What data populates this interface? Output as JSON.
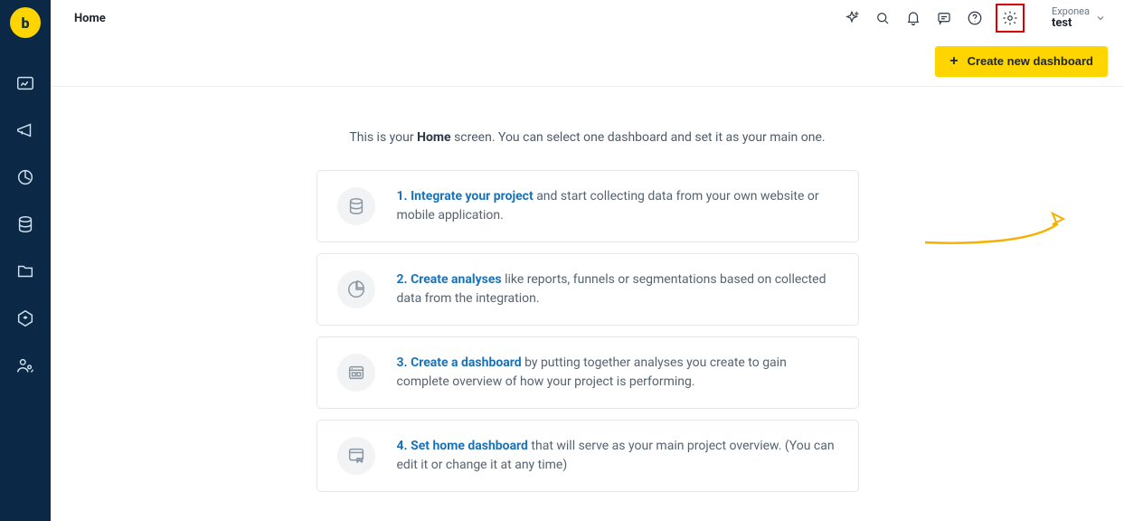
{
  "sidebar": {
    "logo_glyph": "b"
  },
  "topbar": {
    "title": "Home",
    "project": {
      "org": "Exponea",
      "name": "test"
    }
  },
  "actions": {
    "create_dashboard": "Create new dashboard"
  },
  "intro": {
    "prefix": "This is your ",
    "bold": "Home",
    "suffix": " screen. You can select one dashboard and set it as your main one."
  },
  "cards": [
    {
      "icon": "database-icon",
      "link_text": "1. Integrate your project",
      "rest": " and start collecting data from your own website or mobile application."
    },
    {
      "icon": "pie-icon",
      "link_text": "2. Create analyses",
      "rest": " like reports, funnels or segmentations based on collected data from the integration."
    },
    {
      "icon": "dashboard-icon",
      "link_text": "3. Create a dashboard",
      "rest": " by putting together analyses you create to gain complete overview of how your project is performing."
    },
    {
      "icon": "home-dashboard-icon",
      "link_text": "4. Set home dashboard",
      "rest": " that will serve as your main project overview. (You can edit it or change it at any time)"
    }
  ]
}
